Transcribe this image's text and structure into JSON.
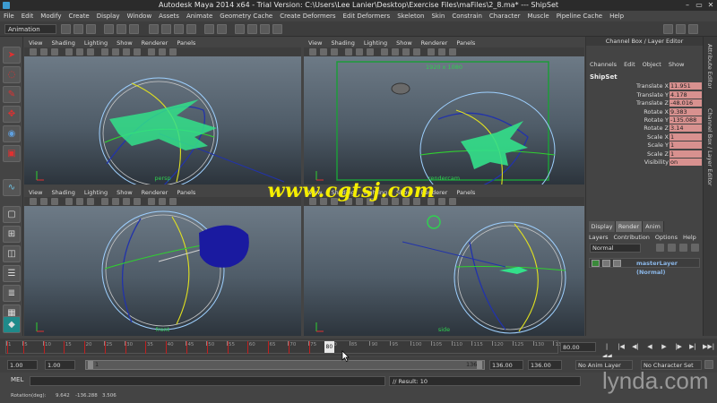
{
  "window": {
    "title": "Autodesk Maya 2014 x64 - Trial Version: C:\\Users\\Lee Lanier\\Desktop\\Exercise Files\\maFiles\\2_8.ma*   ---   ShipSet",
    "controls": [
      "–",
      "▭",
      "✕"
    ]
  },
  "menubar": [
    "File",
    "Edit",
    "Modify",
    "Create",
    "Display",
    "Window",
    "Assets",
    "Animate",
    "Geometry Cache",
    "Create Deformers",
    "Edit Deformers",
    "Skeleton",
    "Skin",
    "Constrain",
    "Character",
    "Muscle",
    "Pipeline Cache",
    "Help"
  ],
  "shelf": {
    "mode": "Animation"
  },
  "panel_menu": [
    "View",
    "Shading",
    "Lighting",
    "Show",
    "Renderer",
    "Panels"
  ],
  "viewports": {
    "top_left": {
      "camera": "persp"
    },
    "top_right": {
      "camera": "rendercam",
      "resolution": "1920 x 1080"
    },
    "bottom_left": {
      "camera": "front"
    },
    "bottom_right": {
      "camera": "side"
    }
  },
  "channel_box": {
    "header": "Channel Box / Layer Editor",
    "menu": [
      "Channels",
      "Edit",
      "Object",
      "Show"
    ],
    "object": "ShipSet",
    "channels": [
      {
        "label": "Translate X",
        "value": "11.951"
      },
      {
        "label": "Translate Y",
        "value": "4.178"
      },
      {
        "label": "Translate Z",
        "value": "-48.016"
      },
      {
        "label": "Rotate X",
        "value": "9.383"
      },
      {
        "label": "Rotate Y",
        "value": "-135.088"
      },
      {
        "label": "Rotate Z",
        "value": "3.14"
      },
      {
        "label": "Scale X",
        "value": "1"
      },
      {
        "label": "Scale Y",
        "value": "1"
      },
      {
        "label": "Scale Z",
        "value": "1"
      },
      {
        "label": "Visibility",
        "value": "on"
      }
    ]
  },
  "layer_editor": {
    "tabs": [
      "Display",
      "Render",
      "Anim"
    ],
    "active_tab": "Render",
    "menu": [
      "Layers",
      "Contribution",
      "Options",
      "Help"
    ],
    "mode": "Normal",
    "layer_name": "masterLayer (Normal)"
  },
  "side_tabs": [
    "Attribute Editor",
    "Channel Box / Layer Editor"
  ],
  "time_slider": {
    "ticks": [
      "1",
      "5",
      "10",
      "15",
      "20",
      "25",
      "30",
      "35",
      "40",
      "45",
      "50",
      "55",
      "60",
      "65",
      "70",
      "75",
      "80",
      "85",
      "90",
      "95",
      "100",
      "105",
      "110",
      "115",
      "120",
      "125",
      "130",
      "135"
    ],
    "current_frame": "80",
    "current_field": "80.00",
    "playback_buttons": [
      "|◀◀",
      "|◀",
      "◀|",
      "◀",
      "▶",
      "|▶",
      "▶|",
      "▶▶|"
    ]
  },
  "range_slider": {
    "start": "1.00",
    "anim_start": "1.00",
    "range_start": "1",
    "range_end": "136",
    "anim_end": "136.00",
    "end": "136.00",
    "anim_layer": "No Anim Layer",
    "character_set": "No Character Set"
  },
  "command_line": {
    "label": "MEL",
    "result": "// Result: 10"
  },
  "help_line": {
    "label": "Rotation(deg):",
    "values": [
      "9.642",
      "-136.288",
      "3.506"
    ]
  },
  "watermarks": {
    "site": "www.cgtsj.com",
    "brand": "lynda.com"
  },
  "colors": {
    "ship_wireframe": "#33e08a",
    "channel_value_bg": "#d8918f",
    "camera_label": "#2fd04f",
    "watermark_yellow": "#f5ee00"
  }
}
